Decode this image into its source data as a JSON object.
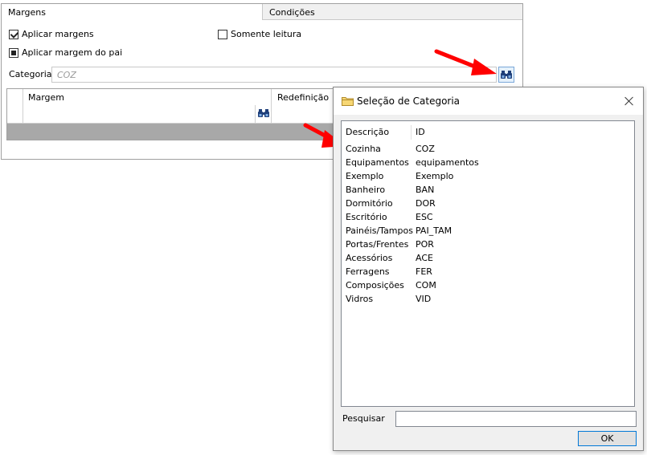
{
  "tabs": {
    "margens": "Margens",
    "condicoes": "Condições"
  },
  "options": {
    "aplicar_margens": "Aplicar margens",
    "somente_leitura": "Somente leitura",
    "aplicar_margem_pai": "Aplicar margem do pai"
  },
  "categoria": {
    "label": "Categoria",
    "value": "COZ"
  },
  "grid": {
    "col_margem": "Margem",
    "col_redefinicao": "Redefinição"
  },
  "dialog": {
    "title": "Seleção de Categoria",
    "list_header": {
      "descricao": "Descrição",
      "id": "ID"
    },
    "rows": [
      {
        "desc": "Cozinha",
        "id": "COZ"
      },
      {
        "desc": "Equipamentos",
        "id": "equipamentos"
      },
      {
        "desc": "Exemplo",
        "id": "Exemplo"
      },
      {
        "desc": "Banheiro",
        "id": "BAN"
      },
      {
        "desc": "Dormitório",
        "id": "DOR"
      },
      {
        "desc": "Escritório",
        "id": "ESC"
      },
      {
        "desc": "Painéis/Tampos",
        "id": "PAI_TAM"
      },
      {
        "desc": "Portas/Frentes",
        "id": "POR"
      },
      {
        "desc": "Acessórios",
        "id": "ACE"
      },
      {
        "desc": "Ferragens",
        "id": "FER"
      },
      {
        "desc": "Composições",
        "id": "COM"
      },
      {
        "desc": "Vidros",
        "id": "VID"
      }
    ],
    "search_label": "Pesquisar",
    "search_value": "",
    "ok_label": "OK"
  },
  "colors": {
    "arrow": "#ff0000",
    "accent": "#0078d7"
  }
}
